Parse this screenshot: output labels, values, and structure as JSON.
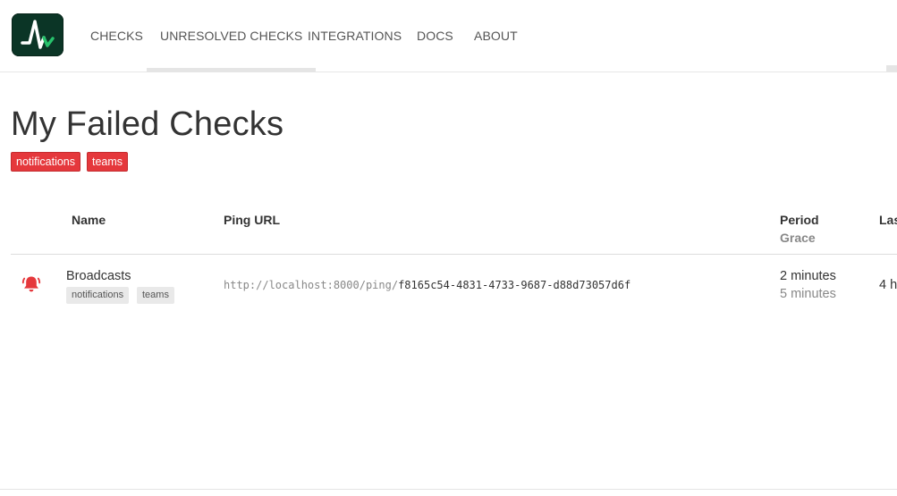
{
  "nav": {
    "items": [
      {
        "label": "CHECKS"
      },
      {
        "label": "UNRESOLVED CHECKS",
        "active": true
      },
      {
        "label": "INTEGRATIONS"
      },
      {
        "label": "DOCS"
      },
      {
        "label": "ABOUT"
      }
    ]
  },
  "page": {
    "title": "My Failed Checks",
    "filter_tags": [
      "notifications",
      "teams"
    ]
  },
  "table": {
    "headers": {
      "name": "Name",
      "ping_url": "Ping URL",
      "period": "Period",
      "grace": "Grace",
      "last_ping_partial": "Las"
    },
    "rows": [
      {
        "status_icon": "bell-icon",
        "name": "Broadcasts",
        "tags": [
          "notifications",
          "teams"
        ],
        "ping_base": "http://localhost:8000/ping/",
        "ping_code": "f8165c54-4831-4733-9687-d88d73057d6f",
        "period": "2 minutes",
        "grace": "5 minutes",
        "last_ping_partial": "4 h"
      }
    ]
  },
  "colors": {
    "brand_bg": "#0b3526",
    "brand_green": "#27c26c",
    "danger": "#e5383c",
    "tag_gray": "#e9e9e9"
  }
}
